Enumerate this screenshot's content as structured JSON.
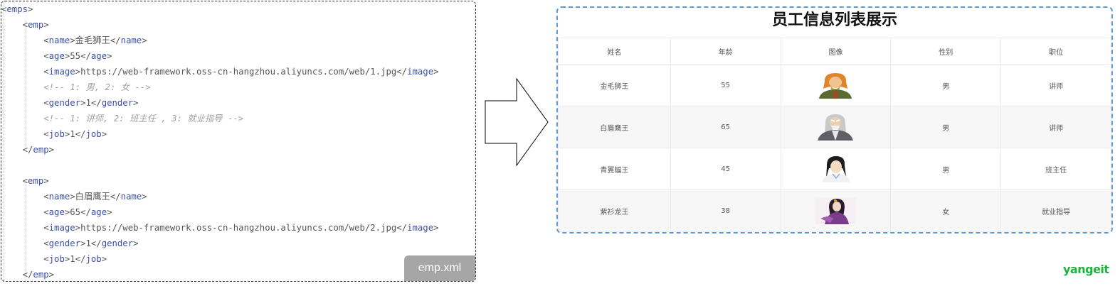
{
  "code_panel": {
    "file_label": "emp.xml",
    "lines": [
      [
        {
          "t": "<",
          "c": "br"
        },
        {
          "t": "emps",
          "c": "tag"
        },
        {
          "t": ">",
          "c": "br"
        }
      ],
      [
        {
          "t": "    <",
          "c": "br"
        },
        {
          "t": "emp",
          "c": "tag"
        },
        {
          "t": ">",
          "c": "br"
        }
      ],
      [
        {
          "t": "        <",
          "c": "br"
        },
        {
          "t": "name",
          "c": "tag"
        },
        {
          "t": ">金毛狮王</",
          "c": "br"
        },
        {
          "t": "name",
          "c": "tag"
        },
        {
          "t": ">",
          "c": "br"
        }
      ],
      [
        {
          "t": "        <",
          "c": "br"
        },
        {
          "t": "age",
          "c": "tag"
        },
        {
          "t": ">55</",
          "c": "br"
        },
        {
          "t": "age",
          "c": "tag"
        },
        {
          "t": ">",
          "c": "br"
        }
      ],
      [
        {
          "t": "        <",
          "c": "br"
        },
        {
          "t": "image",
          "c": "tag"
        },
        {
          "t": ">https://web-framework.oss-cn-hangzhou.aliyuncs.com/web/1.jpg</",
          "c": "br"
        },
        {
          "t": "image",
          "c": "tag"
        },
        {
          "t": ">",
          "c": "br"
        }
      ],
      [
        {
          "t": "        <!-- 1: 男, 2: 女 -->",
          "c": "cmt"
        }
      ],
      [
        {
          "t": "        <",
          "c": "br"
        },
        {
          "t": "gender",
          "c": "tag"
        },
        {
          "t": ">1</",
          "c": "br"
        },
        {
          "t": "gender",
          "c": "tag"
        },
        {
          "t": ">",
          "c": "br"
        }
      ],
      [
        {
          "t": "        <!-- 1: 讲师, 2: 班主任 , 3: 就业指导 -->",
          "c": "cmt"
        }
      ],
      [
        {
          "t": "        <",
          "c": "br"
        },
        {
          "t": "job",
          "c": "tag"
        },
        {
          "t": ">1</",
          "c": "br"
        },
        {
          "t": "job",
          "c": "tag"
        },
        {
          "t": ">",
          "c": "br"
        }
      ],
      [
        {
          "t": "    </",
          "c": "br"
        },
        {
          "t": "emp",
          "c": "tag"
        },
        {
          "t": ">",
          "c": "br"
        }
      ],
      [],
      [
        {
          "t": "    <",
          "c": "br"
        },
        {
          "t": "emp",
          "c": "tag"
        },
        {
          "t": ">",
          "c": "br"
        }
      ],
      [
        {
          "t": "        <",
          "c": "br"
        },
        {
          "t": "name",
          "c": "tag"
        },
        {
          "t": ">白眉鹰王</",
          "c": "br"
        },
        {
          "t": "name",
          "c": "tag"
        },
        {
          "t": ">",
          "c": "br"
        }
      ],
      [
        {
          "t": "        <",
          "c": "br"
        },
        {
          "t": "age",
          "c": "tag"
        },
        {
          "t": ">65</",
          "c": "br"
        },
        {
          "t": "age",
          "c": "tag"
        },
        {
          "t": ">",
          "c": "br"
        }
      ],
      [
        {
          "t": "        <",
          "c": "br"
        },
        {
          "t": "image",
          "c": "tag"
        },
        {
          "t": ">https://web-framework.oss-cn-hangzhou.aliyuncs.com/web/2.jpg</",
          "c": "br"
        },
        {
          "t": "image",
          "c": "tag"
        },
        {
          "t": ">",
          "c": "br"
        }
      ],
      [
        {
          "t": "        <",
          "c": "br"
        },
        {
          "t": "gender",
          "c": "tag"
        },
        {
          "t": ">1</",
          "c": "br"
        },
        {
          "t": "gender",
          "c": "tag"
        },
        {
          "t": ">",
          "c": "br"
        }
      ],
      [
        {
          "t": "        <",
          "c": "br"
        },
        {
          "t": "job",
          "c": "tag"
        },
        {
          "t": ">1</",
          "c": "br"
        },
        {
          "t": "job",
          "c": "tag"
        },
        {
          "t": ">",
          "c": "br"
        }
      ],
      [
        {
          "t": "    </",
          "c": "br"
        },
        {
          "t": "emp",
          "c": "tag"
        },
        {
          "t": ">",
          "c": "br"
        }
      ]
    ]
  },
  "table": {
    "title": "员工信息列表展示",
    "headers": [
      "姓名",
      "年龄",
      "图像",
      "性别",
      "职位"
    ],
    "rows": [
      {
        "name": "金毛狮王",
        "age": "55",
        "avatar": "golden-lion-portrait",
        "gender": "男",
        "job": "讲师"
      },
      {
        "name": "白眉鹰王",
        "age": "65",
        "avatar": "white-eyebrow-eagle-portrait",
        "gender": "男",
        "job": "讲师"
      },
      {
        "name": "青翼蝠王",
        "age": "45",
        "avatar": "green-wing-bat-portrait",
        "gender": "男",
        "job": "班主任"
      },
      {
        "name": "紫衫龙王",
        "age": "38",
        "avatar": "purple-dragon-portrait",
        "gender": "女",
        "job": "就业指导"
      }
    ]
  },
  "brand": {
    "text": "yangeit",
    "color": "#1db33e"
  },
  "colors": {
    "tag": "#3b4fa8",
    "comment": "#a0a0a0",
    "panel_border": "#5b9bd5"
  }
}
